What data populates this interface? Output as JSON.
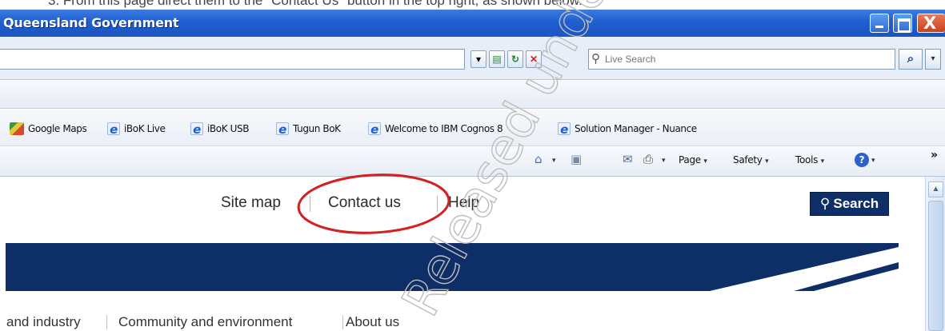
{
  "document": {
    "instruction_text": "3.   From this page direct them to the \"Contact Us\" button in the top right, as shown below."
  },
  "window": {
    "title": "Queensland Government",
    "close_glyph": "X"
  },
  "address_bar": {
    "url": "",
    "search_placeholder": "Live Search",
    "search_go_glyph": "⌕",
    "dropdown_glyph": "▾"
  },
  "favorites": [
    {
      "label": "Google Maps",
      "icon": "google-maps-icon"
    },
    {
      "label": "iBoK Live",
      "icon": "ie-icon"
    },
    {
      "label": "iBoK USB",
      "icon": "ie-icon"
    },
    {
      "label": "Tugun BoK",
      "icon": "ie-icon"
    },
    {
      "label": "Welcome to IBM Cognos 8",
      "icon": "ie-icon"
    },
    {
      "label": "Solution Manager - Nuance",
      "icon": "ie-icon"
    }
  ],
  "command_bar": {
    "home_glyph": "⌂",
    "feeds_glyph": "▣",
    "mail_glyph": "✉",
    "print_glyph": "⎙",
    "page_label": "Page",
    "safety_label": "Safety",
    "tools_label": "Tools",
    "help_glyph": "?",
    "more_glyph": "»",
    "dropdown_glyph": "▾"
  },
  "page": {
    "top_links": [
      "Site map",
      "Contact us",
      "Help"
    ],
    "search_button_label": "Search",
    "search_button_icon": "search-icon",
    "nav_links": [
      "and industry",
      "Community and environment",
      "About us"
    ],
    "brand_color": "#0d2e66",
    "annotation_color": "#d42020"
  },
  "watermark": {
    "text": "Released under"
  }
}
